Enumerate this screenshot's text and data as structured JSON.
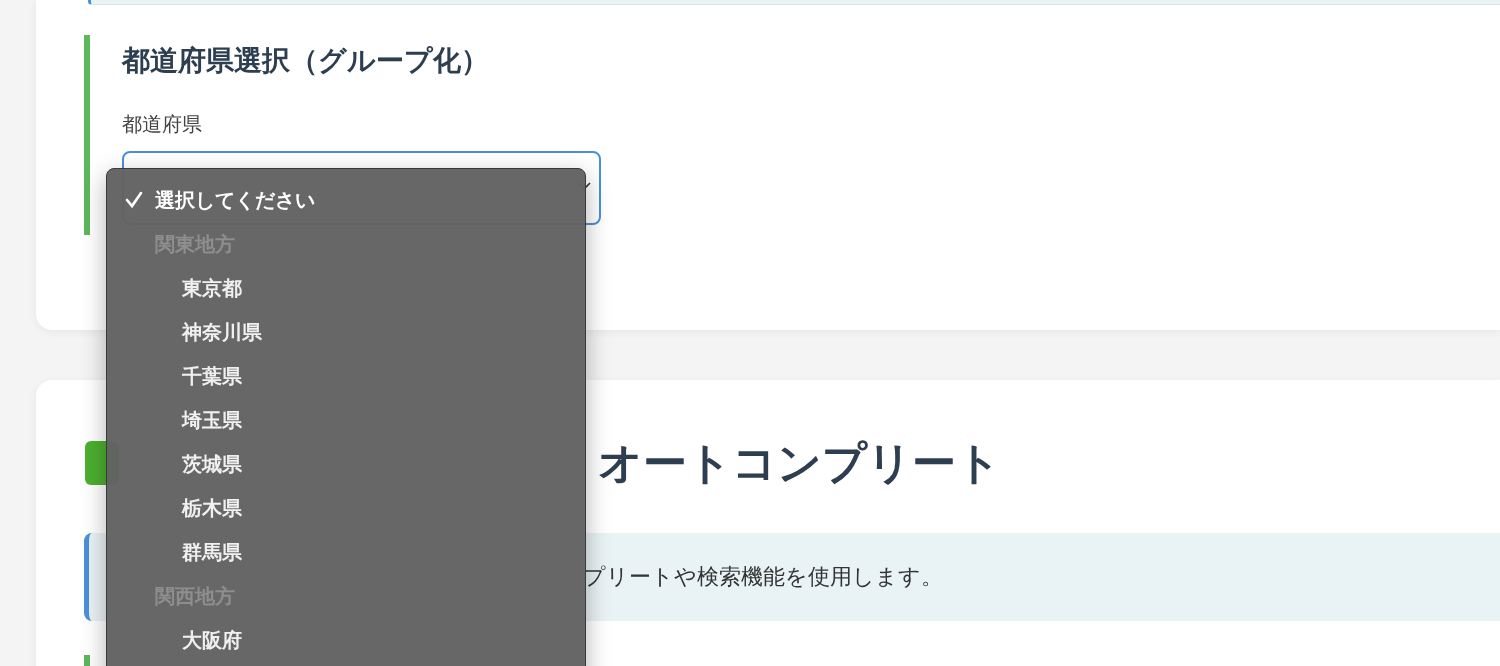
{
  "section_group": {
    "title": "都道府県選択（グループ化）",
    "field_label": "都道府県"
  },
  "section_autocomplete": {
    "title_visible": "オートコンプリート",
    "info_visible": "プリートや検索機能を使用します。"
  },
  "dropdown": {
    "items": [
      {
        "kind": "option",
        "label": "選択してください",
        "selected": true
      },
      {
        "kind": "group",
        "label": "関東地方",
        "children": [
          {
            "label": "東京都",
            "selected": false
          },
          {
            "label": "神奈川県",
            "selected": false
          },
          {
            "label": "千葉県",
            "selected": false
          },
          {
            "label": "埼玉県",
            "selected": false
          },
          {
            "label": "茨城県",
            "selected": false
          },
          {
            "label": "栃木県",
            "selected": false
          },
          {
            "label": "群馬県",
            "selected": false
          }
        ]
      },
      {
        "kind": "group",
        "label": "関西地方",
        "children": [
          {
            "label": "大阪府",
            "selected": false
          }
        ]
      }
    ]
  }
}
